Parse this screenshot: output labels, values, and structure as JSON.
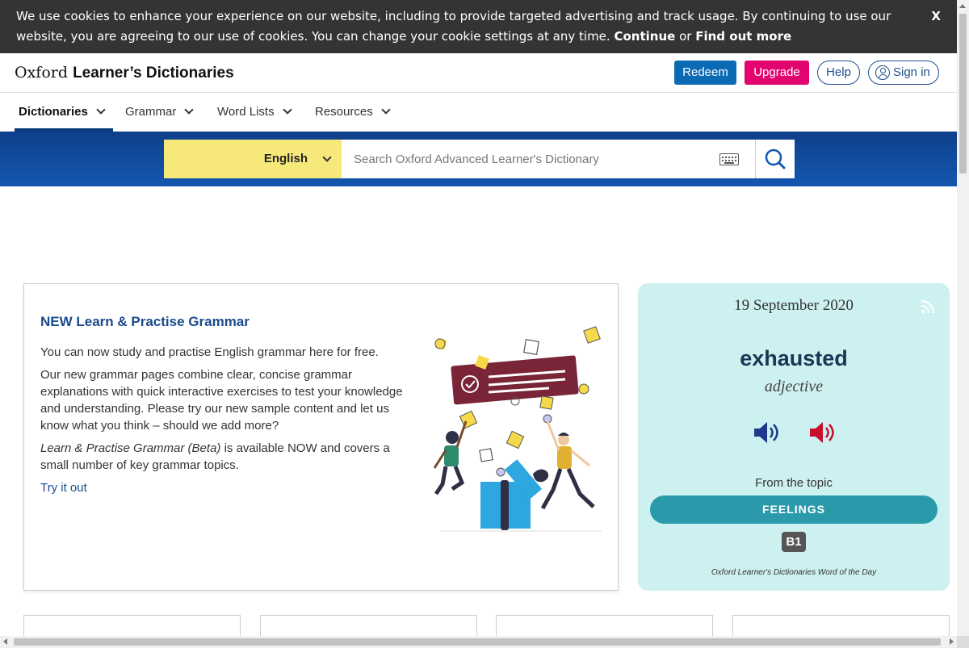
{
  "cookie_banner": {
    "text": "We use cookies to enhance your experience on our website, including to provide targeted advertising and track usage. By continuing to use our website, you are agreeing to our use of cookies. You can change your cookie settings at any time.",
    "continue_label": "Continue",
    "or_text": "or",
    "find_out_more_label": "Find out more",
    "close_label": "X"
  },
  "header": {
    "logo_part1": "Oxford",
    "logo_part2": "Learner’s Dictionaries",
    "redeem_label": "Redeem",
    "upgrade_label": "Upgrade",
    "help_label": "Help",
    "signin_label": "Sign in",
    "colors": {
      "redeem": "#0a6ab3",
      "upgrade": "#e3056f",
      "outline": "#1e4e8c"
    }
  },
  "nav": {
    "items": [
      {
        "label": "Dictionaries",
        "active": true
      },
      {
        "label": "Grammar"
      },
      {
        "label": "Word Lists"
      },
      {
        "label": "Resources"
      }
    ]
  },
  "search": {
    "language": "English",
    "placeholder": "Search Oxford Advanced Learner's Dictionary",
    "value": ""
  },
  "grammar_card": {
    "title": "NEW Learn & Practise Grammar",
    "p1": "You can now study and practise English grammar here for free.",
    "p2": "Our new grammar pages combine clear, concise grammar explanations with quick interactive exercises to test your knowledge and understanding. Please try our new sample content and let us know what you think – should we add more?",
    "p3_italic": "Learn & Practise Grammar (Beta)",
    "p3_rest": " is available NOW and covers a small number of key grammar topics.",
    "link_label": "Try it out"
  },
  "word_of_day": {
    "date": "19 September 2020",
    "word": "exhausted",
    "pos": "adjective",
    "from_topic_label": "From the topic",
    "topic": "FEELINGS",
    "level": "B1",
    "footer": "Oxford Learner's Dictionaries Word of the Day",
    "colors": {
      "background": "#cdf0f0",
      "topic": "#2a9aab",
      "uk_audio": "#1e3a8a",
      "us_audio": "#c8102e"
    }
  }
}
